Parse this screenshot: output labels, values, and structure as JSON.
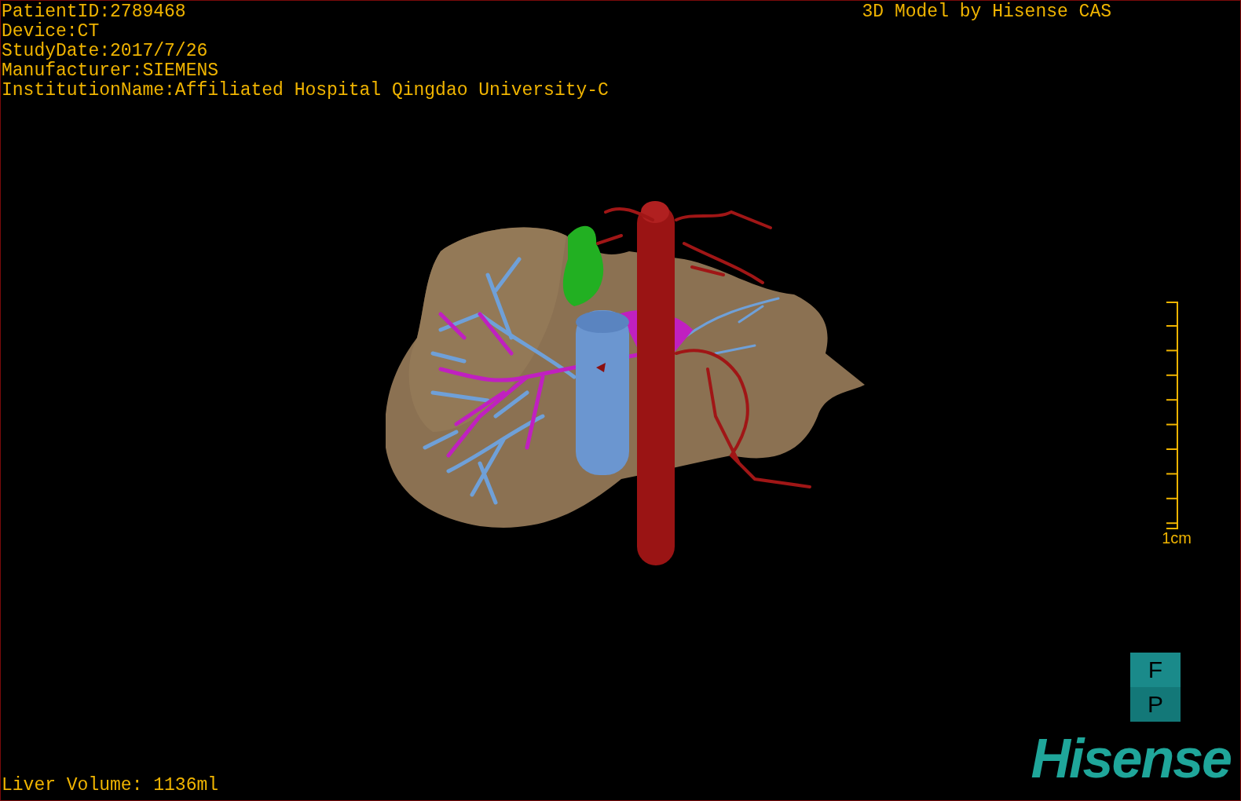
{
  "patient_info": [
    "PatientID:2789468",
    "Device:CT",
    "StudyDate:2017/7/26",
    "Manufacturer:SIEMENS",
    "InstitutionName:Affiliated Hospital Qingdao University-C"
  ],
  "title": "3D Model by Hisense CAS",
  "scale_bar": {
    "label": "1cm"
  },
  "orientation": [
    "F",
    "P"
  ],
  "logo": "Hisense",
  "liver_volume": "Liver Volume: 1136ml"
}
